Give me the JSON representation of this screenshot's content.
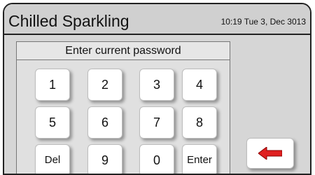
{
  "header": {
    "title": "Chilled Sparkling",
    "datetime": "10:19 Tue 3, Dec 3013"
  },
  "keypad": {
    "prompt": "Enter current password",
    "keys": {
      "k1": "1",
      "k2": "2",
      "k3": "3",
      "k4": "4",
      "k5": "5",
      "k6": "6",
      "k7": "7",
      "k8": "8",
      "del": "Del",
      "k9": "9",
      "k0": "0",
      "enter": "Enter"
    }
  },
  "back_button": {
    "icon": "left-arrow-icon",
    "icon_color": "#e02020"
  }
}
